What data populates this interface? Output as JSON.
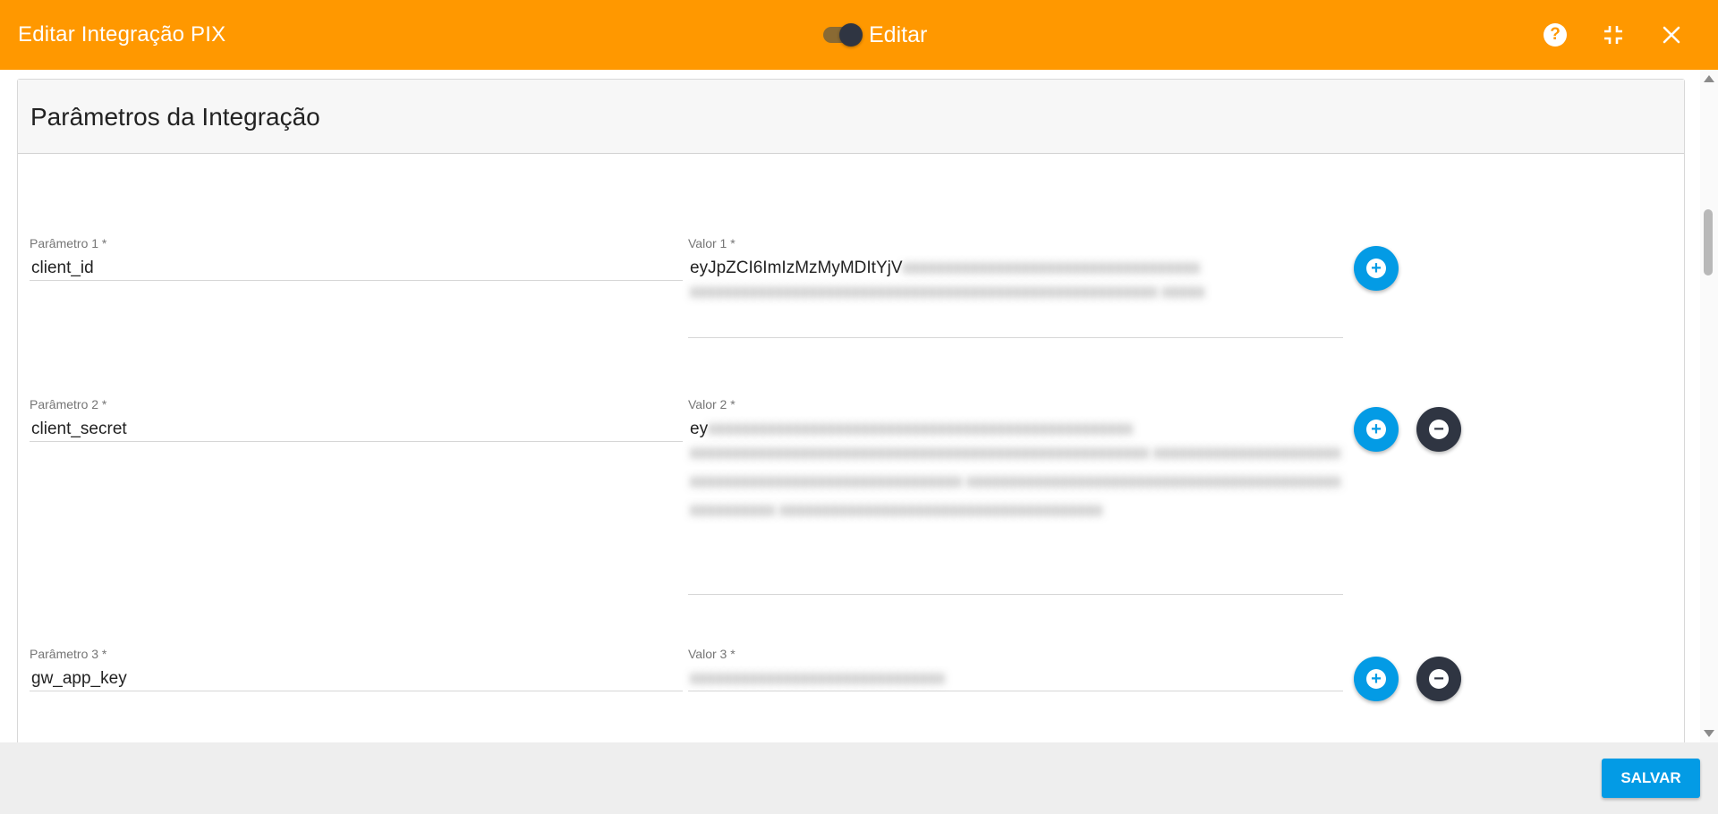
{
  "header": {
    "title": "Editar Integração PIX",
    "toggle_label": "Editar",
    "toggle_on": true,
    "icons": [
      "help-icon",
      "compress-icon",
      "close-icon"
    ]
  },
  "section": {
    "title": "Parâmetros da Integração"
  },
  "params": [
    {
      "param_label": "Parâmetro 1 *",
      "param_value": "client_id",
      "value_label": "Valor 1 *",
      "value_visible": "eyJpZCI6ImIzMzMyMDItYjV",
      "value_redacted": true
    },
    {
      "param_label": "Parâmetro 2 *",
      "param_value": "client_secret",
      "value_label": "Valor 2 *",
      "value_visible": "ey",
      "value_redacted": true
    },
    {
      "param_label": "Parâmetro 3 *",
      "param_value": "gw_app_key",
      "value_label": "Valor 3 *",
      "value_visible": "",
      "value_redacted": true
    }
  ],
  "footer": {
    "save_label": "SALVAR"
  },
  "colors": {
    "header_bg": "#ff9800",
    "primary": "#039be5",
    "dark": "#2f3542",
    "footer_bg": "#eeeeee"
  }
}
